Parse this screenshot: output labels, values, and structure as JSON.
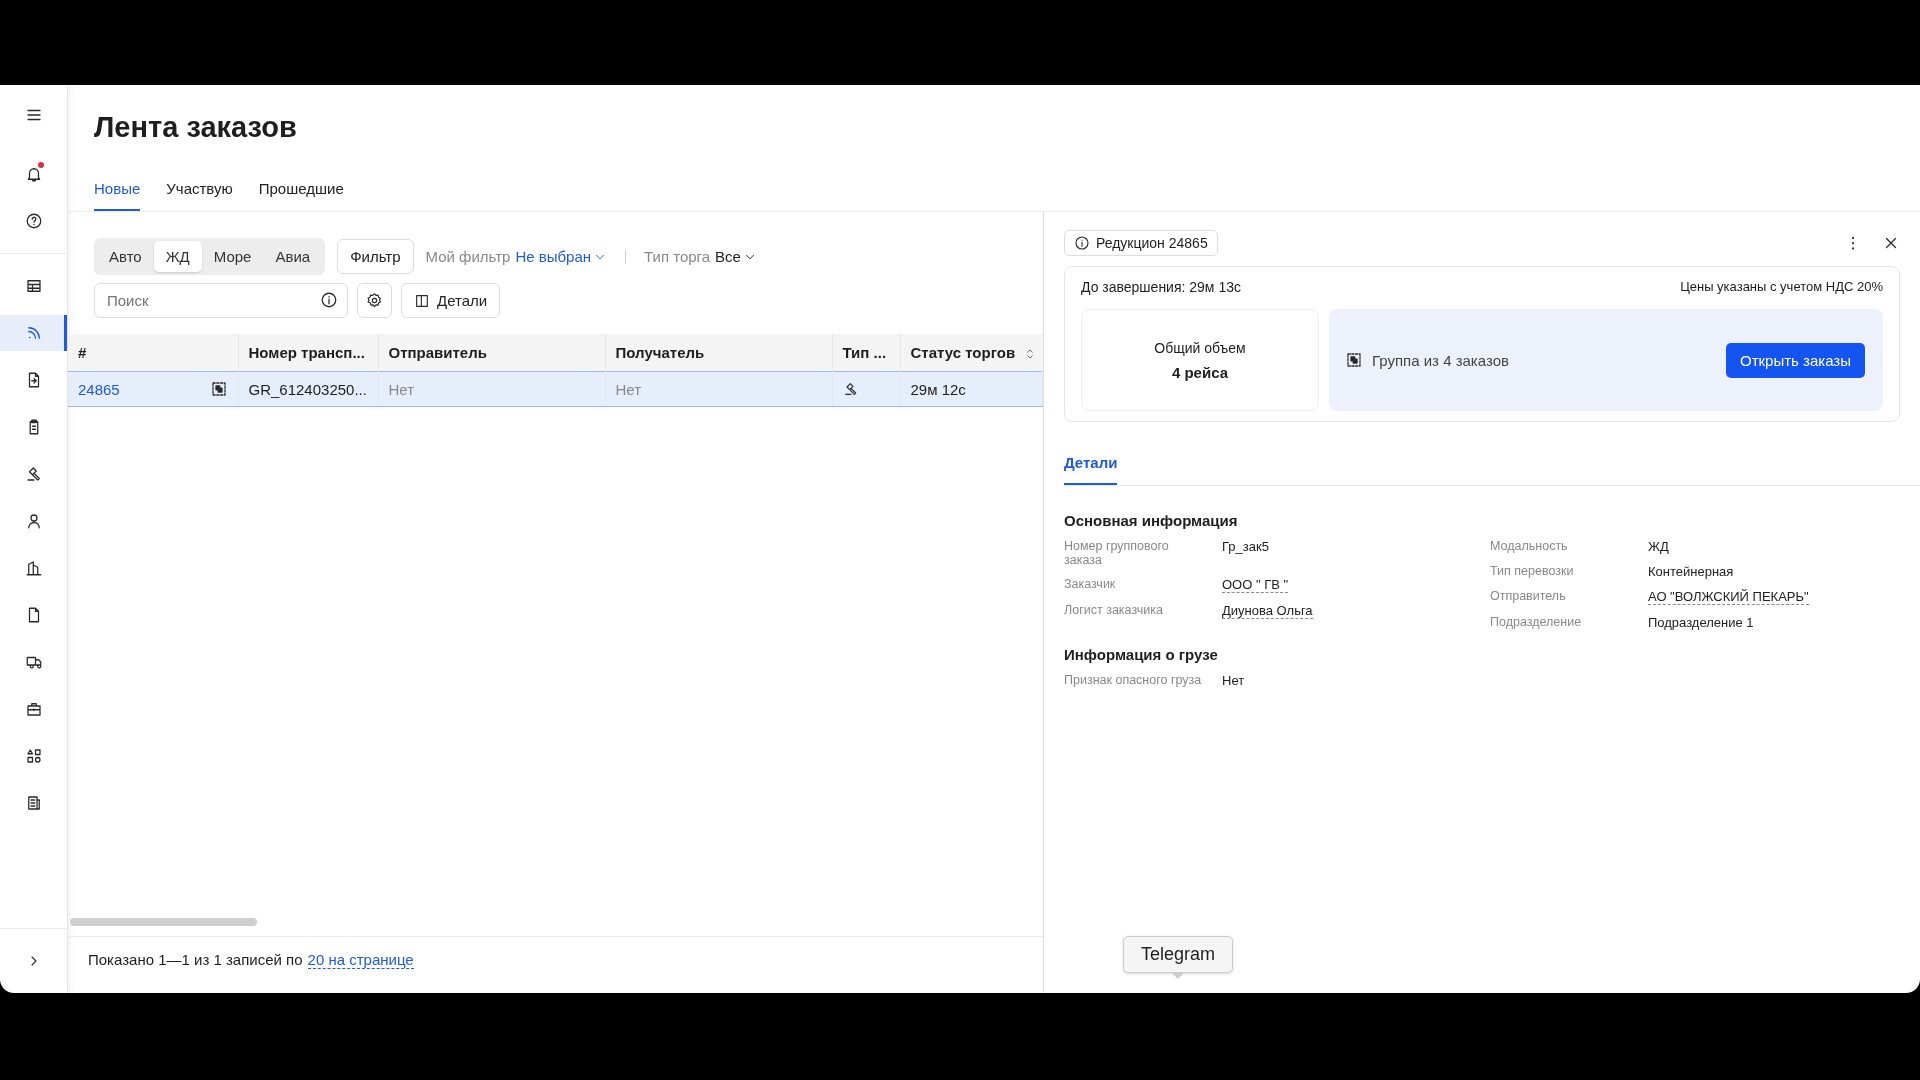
{
  "sidebar": {
    "top": [
      {
        "kind": "menu",
        "selected": false
      },
      {
        "kind": "bell",
        "selected": false,
        "badge": true
      },
      {
        "kind": "help",
        "selected": false
      }
    ],
    "items": [
      {
        "kind": "table",
        "selected": false
      },
      {
        "kind": "feed",
        "selected": true
      },
      {
        "kind": "doc",
        "selected": false
      },
      {
        "kind": "clipboard",
        "selected": false
      },
      {
        "kind": "gavel",
        "selected": false
      },
      {
        "kind": "user",
        "selected": false
      },
      {
        "kind": "building",
        "selected": false
      },
      {
        "kind": "file",
        "selected": false
      },
      {
        "kind": "truck",
        "selected": false
      },
      {
        "kind": "briefcase",
        "selected": false
      },
      {
        "kind": "shapes",
        "selected": false
      },
      {
        "kind": "news",
        "selected": false
      }
    ]
  },
  "page": {
    "title": "Лента заказов"
  },
  "tabs": [
    {
      "label": "Новые",
      "selected": true
    },
    {
      "label": "Участвую",
      "selected": false
    },
    {
      "label": "Прошедшие",
      "selected": false
    }
  ],
  "transport_modes": [
    {
      "label": "Авто",
      "selected": false
    },
    {
      "label": "ЖД",
      "selected": true
    },
    {
      "label": "Море",
      "selected": false
    },
    {
      "label": "Авиа",
      "selected": false
    }
  ],
  "filter_button": "Фильтр",
  "my_filter": {
    "label": "Мой фильтр",
    "value": "Не выбран"
  },
  "trade_type": {
    "label": "Тип торга",
    "value": "Все"
  },
  "search": {
    "placeholder": "Поиск"
  },
  "details_button": "Детали",
  "table": {
    "columns": [
      "#",
      "Номер трансп...",
      "Отправитель",
      "Получатель",
      "Тип ...",
      "Статус торгов"
    ],
    "rows": [
      {
        "id": "24865",
        "grouped": true,
        "number": "GR_612403250...",
        "sender": "Нет",
        "recipient": "Нет",
        "status": "29м 12с",
        "selected": true
      }
    ]
  },
  "footer": {
    "summary": "Показано 1—1 из 1 записей по",
    "page_size": "20 на странице"
  },
  "panel": {
    "chip": "Редукцион 24865",
    "countdown": "До завершения: 29м 13с",
    "vat_note": "Цены указаны с учетом НДС 20%",
    "volume": {
      "label": "Общий объем",
      "value": "4 рейса"
    },
    "group": {
      "label": "Группа из 4 заказов",
      "button": "Открыть заказы"
    },
    "tabs": [
      {
        "label": "Детали",
        "selected": true
      }
    ],
    "sections": [
      {
        "title": "Основная информация",
        "columns": [
          [
            {
              "label": "Номер группового заказа",
              "value": "Гр_зак5",
              "link": false
            },
            {
              "label": "Заказчик",
              "value": "ООО \" ГВ \"",
              "link": true
            },
            {
              "label": "Логист заказчика",
              "value": "Диунова Ольга",
              "link": true
            }
          ],
          [
            {
              "label": "Модальность",
              "value": "ЖД",
              "link": false
            },
            {
              "label": "Тип перевозки",
              "value": "Контейнерная",
              "link": false
            },
            {
              "label": "Отправитель",
              "value": "АО \"ВОЛЖСКИЙ ПЕКАРЬ\"",
              "link": true
            },
            {
              "label": "Подразделение",
              "value": "Подразделение 1",
              "link": false
            }
          ]
        ]
      },
      {
        "title": "Информация о грузе",
        "columns": [
          [
            {
              "label": "Признак опасного груза",
              "value": "Нет",
              "link": false
            }
          ]
        ]
      }
    ]
  },
  "tooltip": "Telegram"
}
